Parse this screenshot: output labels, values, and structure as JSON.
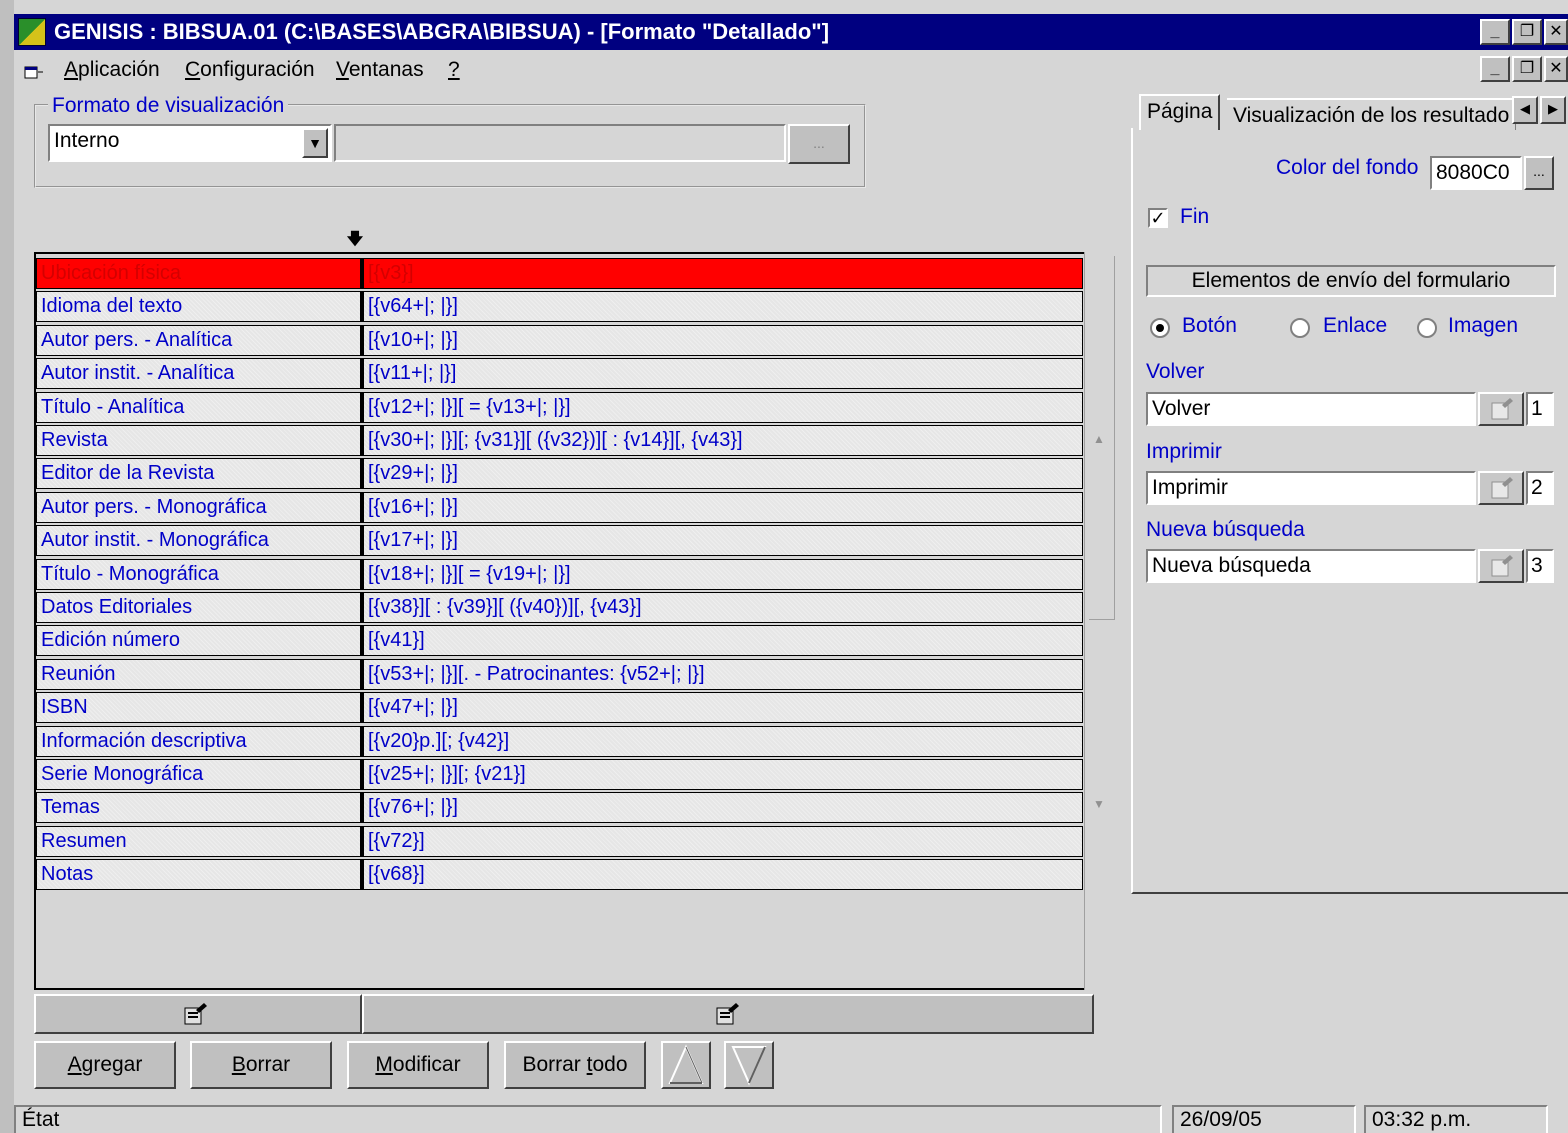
{
  "window": {
    "title": "GENISIS : BIBSUA.01 (C:\\BASES\\ABGRA\\BIBSUA) - [Formato \"Detallado\"]"
  },
  "menu": {
    "items": [
      {
        "pre": "",
        "u": "A",
        "post": "plicación"
      },
      {
        "pre": "",
        "u": "C",
        "post": "onfiguración"
      },
      {
        "pre": "",
        "u": "V",
        "post": "entanas"
      },
      {
        "pre": "",
        "u": "?",
        "post": ""
      }
    ]
  },
  "format_group": {
    "label": "Formato de visualización",
    "select_value": "Interno",
    "path_value": "",
    "browse_label": "..."
  },
  "grid": {
    "rows": [
      {
        "field": "Ubicación física",
        "format": "[{v3}]",
        "selected": true
      },
      {
        "field": "Idioma del texto",
        "format": "[{v64+|; |}]"
      },
      {
        "field": "Autor pers. - Analítica",
        "format": "[{v10+|; |}]"
      },
      {
        "field": "Autor instit. - Analítica",
        "format": "[{v11+|; |}]"
      },
      {
        "field": "Título - Analítica",
        "format": "[{v12+|; |}][ = {v13+|; |}]"
      },
      {
        "field": "Revista",
        "format": "[{v30+|; |}][; {v31}][ ({v32})][ : {v14}][, {v43}]"
      },
      {
        "field": "Editor de la Revista",
        "format": "[{v29+|; |}]"
      },
      {
        "field": "Autor pers. - Monográfica",
        "format": "[{v16+|; |}]"
      },
      {
        "field": "Autor instit. - Monográfica",
        "format": "[{v17+|; |}]"
      },
      {
        "field": "Título - Monográfica",
        "format": "[{v18+|; |}][ = {v19+|; |}]"
      },
      {
        "field": "Datos Editoriales",
        "format": "[{v38}][ : {v39}][ ({v40})][, {v43}]"
      },
      {
        "field": "Edición número",
        "format": "[{v41}]"
      },
      {
        "field": "Reunión",
        "format": "[{v53+|; |}][. - Patrocinantes: {v52+|; |}]"
      },
      {
        "field": "ISBN",
        "format": "[{v47+|; |}]"
      },
      {
        "field": "Información descriptiva",
        "format": "[{v20}p.][; {v42}]"
      },
      {
        "field": "Serie Monográfica",
        "format": "[{v25+|; |}][; {v21}]"
      },
      {
        "field": "Temas",
        "format": "[{v76+|; |}]"
      },
      {
        "field": "Resumen",
        "format": "[{v72}]"
      },
      {
        "field": "Notas",
        "format": "[{v68}]"
      }
    ]
  },
  "actions": {
    "agregar": {
      "u": "A",
      "rest": "gregar"
    },
    "borrar": {
      "u": "B",
      "rest": "orrar"
    },
    "modificar": {
      "u": "M",
      "rest": "odificar"
    },
    "borrar_todo": {
      "pre": "Borrar ",
      "u": "t",
      "rest": "odo"
    }
  },
  "tabs": {
    "pagina": "Página",
    "visualizacion": "Visualización de los resultado"
  },
  "page_settings": {
    "bg_color_label": "Color del fondo",
    "bg_color_value": "8080C0",
    "fin_label": "Fin",
    "fin_checked": true,
    "send_elements_label": "Elementos de envío del formulario",
    "radio_boton": "Botón",
    "radio_enlace": "Enlace",
    "radio_imagen": "Imagen",
    "selected_radio": "Botón",
    "volver_label": "Volver",
    "volver_value": "Volver",
    "volver_num": "1",
    "imprimir_label": "Imprimir",
    "imprimir_value": "Imprimir",
    "imprimir_num": "2",
    "nueva_label": "Nueva búsqueda",
    "nueva_value": "Nueva búsqueda",
    "nueva_num": "3"
  },
  "status": {
    "state": "État",
    "date": "26/09/05",
    "time": "03:32 p.m."
  }
}
